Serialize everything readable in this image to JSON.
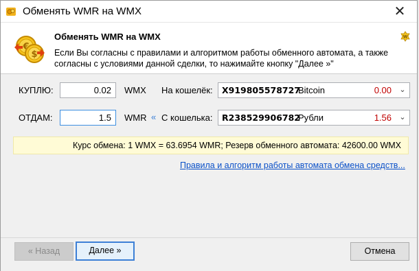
{
  "window": {
    "title": "Обменять WMR на WMX",
    "close_glyph": "✕",
    "app_icon": "webmoney-keeper-icon"
  },
  "header": {
    "title": "Обменять WMR на WMX",
    "description": "Если Вы согласны с правилами и алгоритмом работы обменного автомата, а также согласны с условиями данной сделки, то нажимайте кнопку \"Далее »\"",
    "icon": "coins-exchange-icon",
    "badge_icon": "webmoney-badge-icon"
  },
  "form": {
    "buy": {
      "label": "КУПЛЮ:",
      "value": "0.02",
      "currency": "WMX",
      "wallet_label": "На кошелёк:",
      "wallet": {
        "account": "X919805578727",
        "name": "Bitcoin",
        "balance": "0.00"
      }
    },
    "give": {
      "label": "ОТДАМ:",
      "value": "1.5",
      "currency": "WMR",
      "direction_glyph": "«",
      "wallet_label": "С кошелька:",
      "wallet": {
        "account": "R238529906782",
        "name": "Рубли",
        "balance": "1.56"
      }
    },
    "dropdown_glyph": "⌄"
  },
  "rate": {
    "text": "Курс обмена: 1 WMX = 63.6954 WMR; Резерв обменного автомата: 42600.00 WMX"
  },
  "rules_link": "Правила и алгоритм работы автомата обмена средств...",
  "buttons": {
    "back": "« Назад",
    "next": "Далее »",
    "cancel": "Отмена"
  },
  "colors": {
    "accent": "#3c7fd6",
    "negative_amount": "#c00000",
    "link": "#0a50c8",
    "rate_bar": "#fffbd6"
  }
}
